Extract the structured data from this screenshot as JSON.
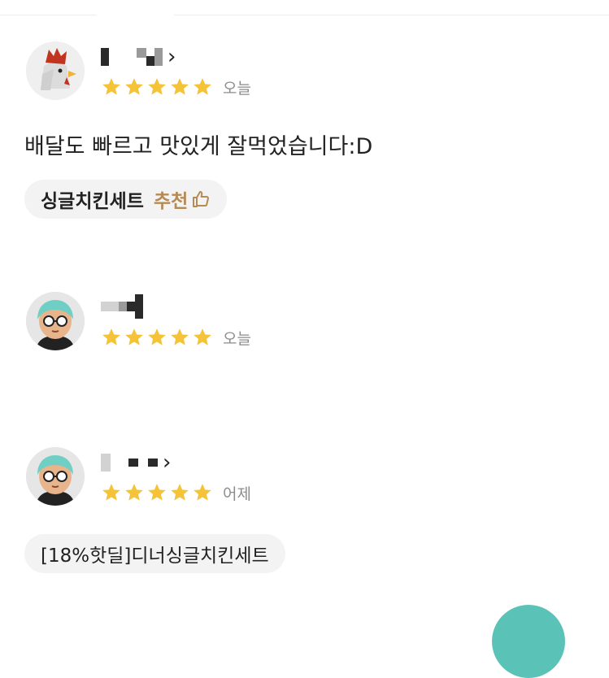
{
  "reviews": [
    {
      "avatar": "chicken-avatar",
      "rating": 5,
      "date": "오늘",
      "text": "배달도 빠르고 맛있게 잘먹었습니다:D",
      "chip": {
        "menu": "싱글치킨세트",
        "recommend": "추천"
      }
    },
    {
      "avatar": "person-avatar",
      "rating": 5,
      "date": "오늘"
    },
    {
      "avatar": "person-avatar",
      "rating": 5,
      "date": "어제",
      "chip": {
        "menu": "[18%핫딜]디너싱글치킨세트"
      }
    }
  ],
  "colors": {
    "star": "#f5c338",
    "recommend": "#b48a55",
    "accent": "#5bc2b7"
  }
}
